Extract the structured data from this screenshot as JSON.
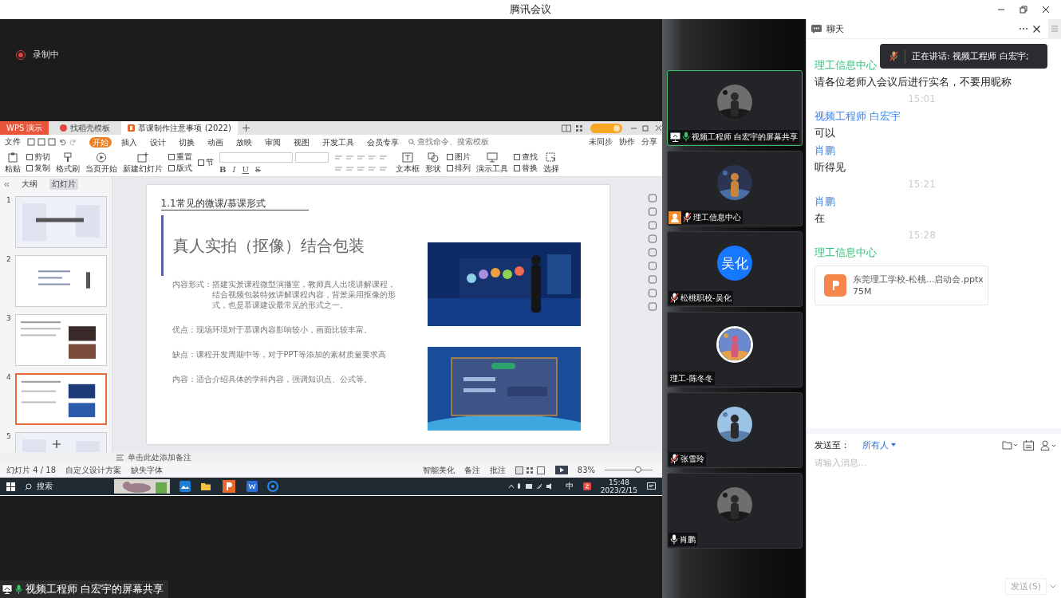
{
  "window": {
    "title": "腾讯会议"
  },
  "recording": {
    "label": "录制中",
    "on": true
  },
  "shared_screen": {
    "app_tabs": [
      {
        "label": "WPS 演示",
        "kind": "brand",
        "selected": false
      },
      {
        "label": "找稻壳模板",
        "kind": "store",
        "selected": false
      },
      {
        "label": "慕课制作注意事项 (2022)",
        "kind": "document",
        "selected": true
      }
    ],
    "menu": {
      "file": "文件",
      "tabs": [
        {
          "label": "开始",
          "selected": true
        },
        {
          "label": "插入",
          "selected": false
        },
        {
          "label": "设计",
          "selected": false
        },
        {
          "label": "切换",
          "selected": false
        },
        {
          "label": "动画",
          "selected": false
        },
        {
          "label": "放映",
          "selected": false
        },
        {
          "label": "审阅",
          "selected": false
        },
        {
          "label": "视图",
          "selected": false
        },
        {
          "label": "开发工具",
          "selected": false
        },
        {
          "label": "会员专享",
          "selected": false
        }
      ],
      "search": "查找命令、搜索模板",
      "actions": [
        "未同步",
        "协作",
        "分享"
      ]
    },
    "ribbon": [
      {
        "kind": "big",
        "labels": [
          "粘贴"
        ]
      },
      {
        "kind": "pair",
        "labels": [
          "剪切",
          "复制"
        ]
      },
      {
        "kind": "big",
        "labels": [
          "格式刷"
        ]
      },
      {
        "kind": "big",
        "labels": [
          "当页开始"
        ]
      },
      {
        "kind": "big",
        "labels": [
          "新建幻灯片"
        ]
      },
      {
        "kind": "pair",
        "labels": [
          "重置",
          "版式"
        ]
      },
      {
        "kind": "pair",
        "labels": [
          "节"
        ]
      },
      {
        "kind": "font",
        "labels": [
          "B",
          "I",
          "U",
          "S"
        ]
      },
      {
        "kind": "paragraph"
      },
      {
        "kind": "big",
        "labels": [
          "文本框"
        ]
      },
      {
        "kind": "big",
        "labels": [
          "形状"
        ]
      },
      {
        "kind": "pair",
        "labels": [
          "图片",
          "排列"
        ]
      },
      {
        "kind": "big",
        "labels": [
          "演示工具"
        ]
      },
      {
        "kind": "pair",
        "labels": [
          "查找",
          "替换"
        ]
      },
      {
        "kind": "big",
        "labels": [
          "选择"
        ]
      }
    ],
    "panes": [
      {
        "label": "大纲",
        "selected": false
      },
      {
        "label": "幻灯片",
        "selected": true
      }
    ],
    "thumbnails": [
      {
        "number": "1",
        "selected": false
      },
      {
        "number": "2",
        "selected": false
      },
      {
        "number": "3",
        "selected": false
      },
      {
        "number": "4",
        "selected": true
      },
      {
        "number": "5",
        "selected": false
      }
    ],
    "slide": {
      "heading": "1.1常见的微课/慕课形式",
      "title": "真人实拍（抠像）结合包装",
      "paragraphs": [
        {
          "label": "内容形式：",
          "text": "搭建实景课程微型演播室，教师真人出境讲解课程，结合视频包装特效讲解课程内容，背景采用抠像的形式，也是慕课建设最常见的形式之一。"
        },
        {
          "label": "优点：",
          "text": "现场环境对于慕课内容影响较小，画面比较丰富。"
        },
        {
          "label": "缺点：",
          "text": "课程开发周期中等，对于PPT等添加的素材质量要求高"
        },
        {
          "label": "内容：",
          "text": "适合介绍具体的学科内容，强调知识点、公式等。"
        }
      ]
    },
    "notes_placeholder": "单击此处添加备注",
    "status": {
      "left": [
        "幻灯片 4 / 18",
        "自定义设计方案",
        "缺失字体"
      ],
      "right": [
        "智能美化",
        "备注",
        "批注"
      ],
      "zoom": "83%",
      "level": 0.7
    },
    "taskbar": {
      "search": "搜索",
      "ime": "中",
      "time": "15:48",
      "date": "2023/2/15"
    }
  },
  "share_label": "视频工程师 白宏宇的屏幕共享",
  "participants": [
    {
      "name": "视频工程师 白宏宇的屏幕共享",
      "speaking": true,
      "sharing": true,
      "host": false,
      "muted": false
    },
    {
      "name": "理工信息中心",
      "speaking": false,
      "sharing": false,
      "host": true,
      "muted": true
    },
    {
      "name": "松桃职校-吴化",
      "speaking": false,
      "sharing": false,
      "host": false,
      "muted": true,
      "avatar": {
        "kind": "initials",
        "text": "吴化"
      }
    },
    {
      "name": "理工-陈冬冬",
      "speaking": false,
      "sharing": false,
      "host": false
    },
    {
      "name": "张雪玲",
      "speaking": false,
      "sharing": false,
      "host": false,
      "muted": true
    },
    {
      "name": "肖鹏",
      "speaking": false,
      "sharing": false,
      "host": false,
      "muted": false
    }
  ],
  "chat": {
    "title": "聊天",
    "toast": "正在讲话: 视频工程师 白宏宇;",
    "items": [
      {
        "kind": "message",
        "sender": "理工信息中心",
        "color": "#2fc27a",
        "text": "请各位老师入会议后进行实名，不要用昵称"
      },
      {
        "kind": "time",
        "text": "15:01"
      },
      {
        "kind": "message",
        "sender": "视频工程师 白宏宇",
        "color": "#3b86f0",
        "text": "可以"
      },
      {
        "kind": "message",
        "sender": "肖鹏",
        "color": "#3b86f0",
        "text": "听得见"
      },
      {
        "kind": "time",
        "text": "15:21"
      },
      {
        "kind": "message",
        "sender": "肖鹏",
        "color": "#3b86f0",
        "text": "在"
      },
      {
        "kind": "time",
        "text": "15:28"
      },
      {
        "kind": "file",
        "sender": "理工信息中心",
        "color": "#2fc27a",
        "file_name": "东莞理工学校-松桃...启动会.pptx",
        "size": "75M"
      }
    ],
    "send_to_label": "发送至：",
    "recipient": "所有人",
    "placeholder": "请输入消息...",
    "send_button": "发送(S)"
  }
}
